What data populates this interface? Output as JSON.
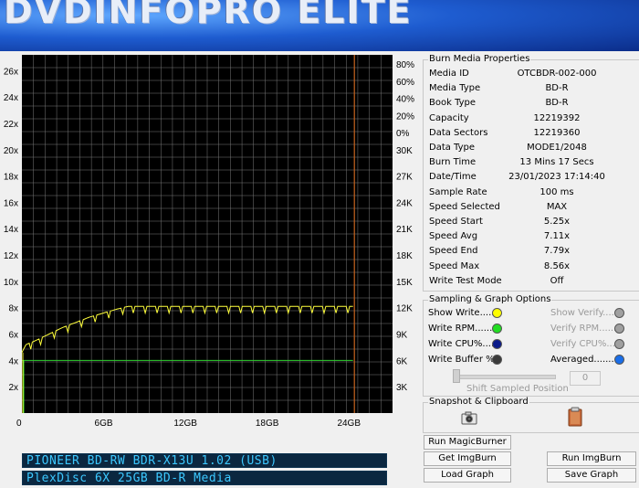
{
  "app": {
    "title": "DVDInfoPro Elite"
  },
  "chart_data": {
    "type": "line",
    "x_ticks": [
      "0",
      "6GB",
      "12GB",
      "18GB",
      "24GB"
    ],
    "x_max_gb": 27.2,
    "y_left_ticks": [
      "26x",
      "24x",
      "22x",
      "20x",
      "18x",
      "16x",
      "14x",
      "12x",
      "10x",
      "8x",
      "6x",
      "4x",
      "2x"
    ],
    "y_right_pct_ticks": [
      "80%",
      "60%",
      "40%",
      "20%",
      "0%"
    ],
    "y_right_rpm_ticks": [
      "30K",
      "27K",
      "24K",
      "21K",
      "18K",
      "15K",
      "12K",
      "9K",
      "6K",
      "3K"
    ],
    "y_max": 27.2,
    "disc_end_gb": 24.4,
    "series": [
      {
        "color": "#ffff3c",
        "points": [
          [
            0,
            4.6
          ],
          [
            0.3,
            5.2
          ],
          [
            1,
            5.5
          ],
          [
            2,
            6.0
          ],
          [
            3,
            6.5
          ],
          [
            4,
            6.9
          ],
          [
            5,
            7.3
          ],
          [
            6,
            7.6
          ],
          [
            7,
            7.9
          ],
          [
            7.8,
            8.1
          ],
          [
            24.3,
            8.1
          ]
        ]
      },
      {
        "color": "#2fd02f",
        "points": [
          [
            0,
            4.0
          ],
          [
            24.3,
            4.0
          ]
        ]
      }
    ],
    "grid": true
  },
  "lcd": {
    "line1": "PIONEER BD-RW BDR-X13U 1.02 (USB)",
    "line2": "PlexDisc 6X 25GB BD-R Media"
  },
  "burn_props": {
    "title": "Burn Media Properties",
    "rows": [
      {
        "k": "Media ID",
        "v": "OTCBDR-002-000"
      },
      {
        "k": "Media Type",
        "v": "BD-R"
      },
      {
        "k": "Book Type",
        "v": "BD-R"
      },
      {
        "k": "Capacity",
        "v": "12219392"
      },
      {
        "k": "Data Sectors",
        "v": "12219360"
      },
      {
        "k": "Data Type",
        "v": "MODE1/2048"
      },
      {
        "k": "Burn Time",
        "v": "13 Mins 17 Secs"
      },
      {
        "k": "Date/Time",
        "v": "23/01/2023 17:14:40"
      },
      {
        "k": "Sample Rate",
        "v": "100 ms"
      },
      {
        "k": "Speed Selected",
        "v": "MAX"
      },
      {
        "k": "Speed Start",
        "v": "5.25x"
      },
      {
        "k": "Speed Avg",
        "v": "7.11x"
      },
      {
        "k": "Speed End",
        "v": "7.79x"
      },
      {
        "k": "Speed Max",
        "v": "8.56x"
      },
      {
        "k": "Write Test Mode",
        "v": "Off"
      }
    ]
  },
  "sampling": {
    "title": "Sampling & Graph Options",
    "show_write": "Show Write.....",
    "write_rpm": "Write RPM......",
    "write_cpu": "Write CPU%....",
    "write_buffer": "Write Buffer %.",
    "show_verify": "Show Verify.....",
    "verify_rpm": "Verify RPM......",
    "verify_cpu": "Verify CPU%....",
    "averaged": "Averaged........",
    "slider_value": "0",
    "shift_label": "Shift Sampled Position",
    "colors": {
      "yellow": "#ffff00",
      "green": "#22dd22",
      "navy": "#0a1a8a",
      "dark": "#3a3a3a",
      "blue": "#1a6ee8",
      "gray": "#a0a0a0"
    }
  },
  "snapshot": {
    "title": "Snapshot & Clipboard",
    "camera_icon": "camera-icon",
    "clipboard_icon": "clipboard-icon"
  },
  "buttons": {
    "run_magicburner": "Run MagicBurner",
    "get_imgburn": "Get ImgBurn",
    "run_imgburn": "Run ImgBurn",
    "load_graph": "Load Graph",
    "save_graph": "Save Graph"
  }
}
